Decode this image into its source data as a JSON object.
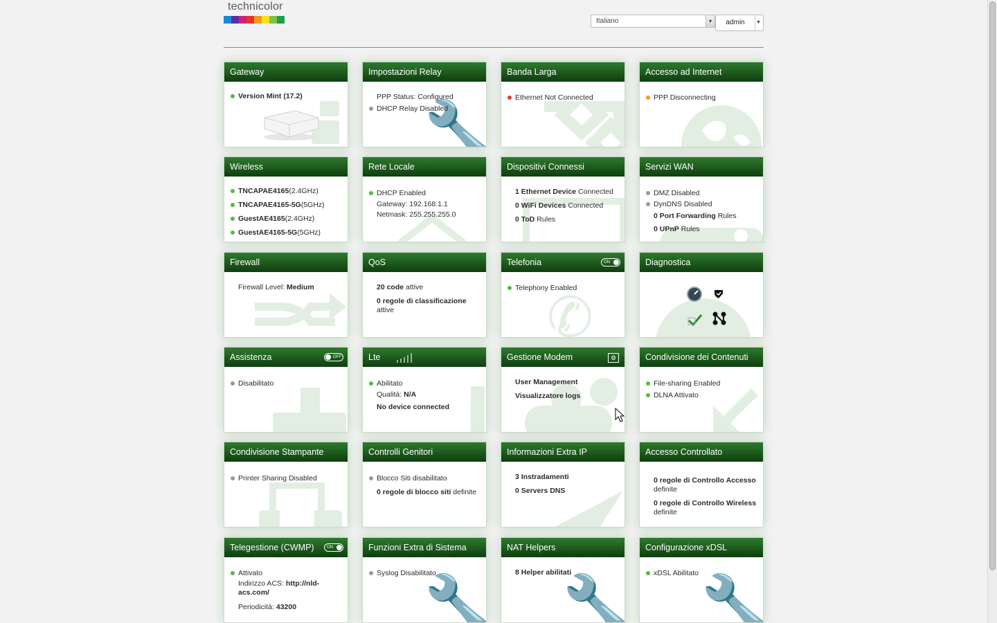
{
  "header": {
    "logo": "technicolor",
    "language": "Italiano",
    "user": "admin"
  },
  "colors": {
    "accent_green": "#1f5f1f",
    "status_green": "#4dbf39",
    "status_gray": "#999999",
    "status_red": "#e23a3a",
    "status_orange": "#f2a01a"
  },
  "cards": {
    "gateway": {
      "title": "Gateway",
      "version": "Version Mint (17.2)"
    },
    "relay": {
      "title": "Impostazioni Relay",
      "ppp": "PPP Status: Configured",
      "dhcp": "DHCP Relay Disabled"
    },
    "broadband": {
      "title": "Banda Larga",
      "status": "Ethernet Not Connected"
    },
    "internet": {
      "title": "Accesso ad Internet",
      "status": "PPP Disconnecting"
    },
    "wireless": {
      "title": "Wireless",
      "networks": [
        {
          "ssid": "TNCAPAE4165",
          "band": "(2.4GHz)"
        },
        {
          "ssid": "TNCAPAE4165-5G",
          "band": "(5GHz)"
        },
        {
          "ssid": "GuestAE4165",
          "band": "(2.4GHz)"
        },
        {
          "ssid": "GuestAE4165-5G",
          "band": "(5GHz)"
        }
      ]
    },
    "lan": {
      "title": "Rete Locale",
      "dhcp": "DHCP Enabled",
      "gateway": "Gateway: 192.168.1.1",
      "netmask": "Netmask: 255.255.255.0"
    },
    "devices": {
      "title": "Dispositivi Connessi",
      "l1b": "1 Ethernet Device",
      "l1": " Connected",
      "l2b": "0 WiFi Devices",
      "l2": " Connected",
      "l3b": "0 ToD",
      "l3": " Rules"
    },
    "wan": {
      "title": "Servizi WAN",
      "dmz": "DMZ Disabled",
      "dyndns": "DynDNS Disabled",
      "pf_b": "0 Port Forwarding",
      "pf": " Rules",
      "upnp_b": "0 UPnP",
      "upnp": " Rules"
    },
    "firewall": {
      "title": "Firewall",
      "label": "Firewall Level: ",
      "level": "Medium"
    },
    "qos": {
      "title": "QoS",
      "l1b": "20 code",
      "l1": " attive",
      "l2b": "0 regole di classificazione",
      "l2": "attive"
    },
    "phone": {
      "title": "Telefonia",
      "toggle": "ON",
      "status": "Telephony Enabled"
    },
    "diag": {
      "title": "Diagnostica"
    },
    "assist": {
      "title": "Assistenza",
      "toggle": "OFF",
      "status": "Disabilitato"
    },
    "lte": {
      "title": "Lte",
      "status": "Abilitato",
      "quality_label": "Qualità: ",
      "quality": "N/A",
      "device": "No device connected"
    },
    "modem": {
      "title": "Gestione Modem",
      "l1": "User Management",
      "l2": "Visualizzatore logs"
    },
    "content": {
      "title": "Condivisione dei Contenuti",
      "l1": "File-sharing Enabled",
      "l2": "DLNA Attivato"
    },
    "printer": {
      "title": "Condivisione Stampante",
      "status": "Printer Sharing Disabled"
    },
    "parental": {
      "title": "Controlli Genitori",
      "l1": "Blocco Siti disabilitato",
      "l2b": "0 regole di blocco siti",
      "l2": " definite"
    },
    "extraip": {
      "title": "Informazioni Extra IP",
      "l1": "3 Instradamenti",
      "l2": "0 Servers DNS"
    },
    "access": {
      "title": "Accesso Controllato",
      "l1b": "0 regole di Controllo Accesso",
      "l1": " definite",
      "l2b": "0 regole di Controllo Wireless",
      "l2": " definite"
    },
    "cwmp": {
      "title": "Telegestione (CWMP)",
      "toggle": "ON",
      "status": "Attivato",
      "acs_label": "Indirizzo ACS: ",
      "acs": "http://nld-acs.com/",
      "period_label": "Periodicità: ",
      "period": "43200"
    },
    "sysextra": {
      "title": "Funzioni Extra di Sistema",
      "status": "Syslog Disabilitato"
    },
    "nat": {
      "title": "NAT Helpers",
      "l1": "8 Helper abilitati"
    },
    "xdsl": {
      "title": "Configurazione xDSL",
      "status": "xDSL Abilitato"
    }
  }
}
